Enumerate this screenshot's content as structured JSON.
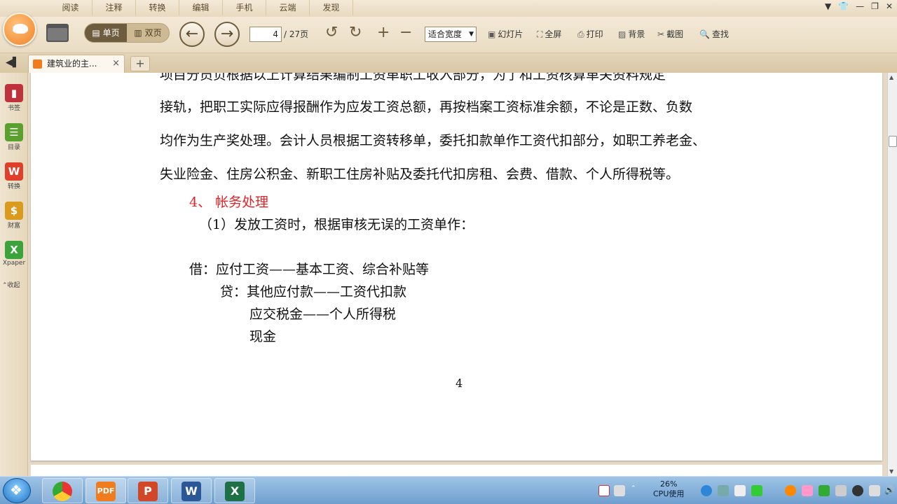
{
  "menu": {
    "tabs": [
      "阅读",
      "注释",
      "转换",
      "编辑",
      "手机",
      "云端",
      "发现"
    ]
  },
  "toolbar": {
    "view_single": "单页",
    "view_double": "双页",
    "page_current": "4",
    "page_total": "/ 27页",
    "zoom_mode": "适合宽度",
    "slideshow": "幻灯片",
    "fullscreen": "全屏",
    "print": "打印",
    "background": "背景",
    "screenshot": "截图",
    "find": "查找"
  },
  "tab": {
    "title": "建筑业的主...",
    "close": "×",
    "add": "+"
  },
  "sidebar": {
    "items": [
      {
        "label": "书签",
        "icon": "bookmark-icon",
        "color": "#c0323b"
      },
      {
        "label": "目录",
        "icon": "toc-icon",
        "color": "#5aa02c"
      },
      {
        "label": "转换",
        "icon": "convert-icon",
        "color": "#e0402a"
      },
      {
        "label": "财富",
        "icon": "wealth-icon",
        "color": "#d99a1e"
      },
      {
        "label": "Xpaper",
        "icon": "xpaper-icon",
        "color": "#3aa33a"
      }
    ],
    "collapse": "收起"
  },
  "document": {
    "lines": [
      "项目分员负根据以上计算结果编制工资单职工收入部分，为了和工资核算单关资料规定",
      "接轨，把职工实际应得报酬作为应发工资总额，再按档案工资标准余额，不论是正数、负数",
      "均作为生产奖处理。会计人员根据工资转移单，委托扣款单作工资代扣部分，如职工养老金、",
      "失业险金、住房公积金、新职工住房补贴及委托代扣房租、会费、借款、个人所得税等。"
    ],
    "heading": "4、  帐务处理",
    "step": "（1）发放工资时，根据审核无误的工资单作：",
    "debit": "借：应付工资——基本工资、综合补贴等",
    "credit1": "贷：其他应付款——工资代扣款",
    "credit2": "应交税金——个人所得税",
    "credit3": "现金",
    "page_number": "4"
  },
  "taskbar": {
    "cpu_percent": "26%",
    "cpu_label": "CPU使用"
  },
  "colors": {
    "accent_red": "#e0242a",
    "ribbon": "#e9dcc3"
  }
}
